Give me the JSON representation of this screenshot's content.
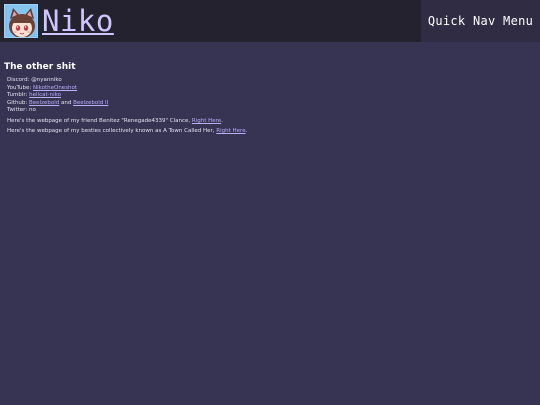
{
  "header": {
    "title": "Niko",
    "nav_label": "Quick Nav Menu"
  },
  "section": {
    "title": "The other shit"
  },
  "contacts": [
    {
      "label": "Discord: ",
      "value": "@nyanniko",
      "links": []
    },
    {
      "label": "YouTube: ",
      "links": [
        {
          "text": "NikotheOneshot"
        }
      ]
    },
    {
      "label": "Tumblr: ",
      "links": [
        {
          "text": "hellcat-niko"
        }
      ]
    },
    {
      "label": "Github: ",
      "links": [
        {
          "text": "Beelzebold"
        },
        {
          "text": "Beelzebold II"
        }
      ],
      "joiner": " and "
    },
    {
      "label": "Twitter: ",
      "value": "no",
      "links": []
    }
  ],
  "paragraphs": [
    {
      "prefix": "Here's the webpage of my friend Benitez \"Renegade4339\" Clance, ",
      "link": "Right Here",
      "suffix": "."
    },
    {
      "prefix": "Here's the webpage of my besties collectively known as A Town Called Her, ",
      "link": "Right Here",
      "suffix": "."
    }
  ],
  "colors": {
    "background": "#363353",
    "header": "#24222f",
    "link": "#b9b0ff"
  },
  "icons": {
    "avatar": "cat-girl-avatar-icon"
  }
}
